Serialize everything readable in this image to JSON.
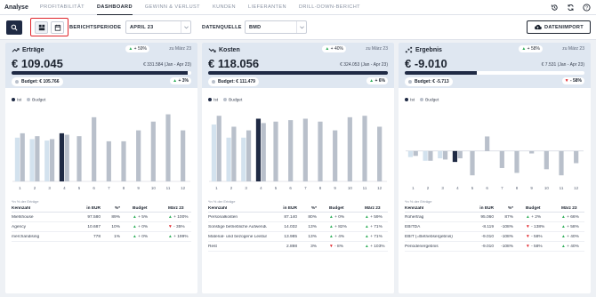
{
  "app": {
    "name": "Analyse",
    "profit_label": "PROFITABILITÄT"
  },
  "nav": [
    {
      "label": "DASHBOARD",
      "active": true
    },
    {
      "label": "GEWINN & VERLUST",
      "active": false
    },
    {
      "label": "KUNDEN",
      "active": false
    },
    {
      "label": "LIEFERANTEN",
      "active": false
    },
    {
      "label": "DRILL-DOWN-BERICHT",
      "active": false
    }
  ],
  "toolbar": {
    "period_label": "BERICHTSPERIODE",
    "period_value": "APRIL 23",
    "source_label": "DATENQUELLE",
    "source_value": "BMD",
    "import_label": "DATENIMPORT"
  },
  "colors": {
    "accent": "#1f2a44",
    "ist_past": "#d3e2ee",
    "budget": "#b9c0cb",
    "up": "#2fae5a",
    "down": "#e0252b",
    "highlight_border": "#e0252b"
  },
  "cards": [
    {
      "title": "Erträge",
      "icon": "trend-up-icon",
      "delta": "+ 59%",
      "delta_dir": "up",
      "delta_ref": "zu März 23",
      "value": "€ 109.045",
      "prev": "€ 331.584 (Jan - Apr 23)",
      "progress": 0.98,
      "budget": "Budget: € 105.766",
      "budget_delta": "+ 3%",
      "budget_dir": "up",
      "legend": {
        "ist": "Ist",
        "budget": "Budget"
      },
      "footnote": "*in % der Erträge",
      "headers": [
        "Kennzahl",
        "in EUR",
        "%*",
        "Budget",
        "März 23"
      ],
      "rows": [
        {
          "name": "Mietshouse",
          "eur": "97.580",
          "pct": "89%",
          "budget": "+ 5%",
          "budget_dir": "up",
          "mar": "+ 100%",
          "mar_dir": "up"
        },
        {
          "name": "Agency",
          "eur": "10.687",
          "pct": "10%",
          "budget": "+ 0%",
          "budget_dir": "up",
          "mar": "- 35%",
          "mar_dir": "down"
        },
        {
          "name": "merchandising",
          "eur": "778",
          "pct": "1%",
          "budget": "+ 0%",
          "budget_dir": "up",
          "mar": "+ 199%",
          "mar_dir": "up"
        }
      ]
    },
    {
      "title": "Kosten",
      "icon": "trend-down-icon",
      "delta": "+ 40%",
      "delta_dir": "up",
      "delta_ref": "zu März 23",
      "value": "€ 118.056",
      "prev": "€ 324.053 (Jan - Apr 23)",
      "progress": 1.0,
      "budget": "Budget: € 111.479",
      "budget_delta": "+ 6%",
      "budget_dir": "up",
      "legend": {
        "ist": "Ist",
        "budget": "Budget"
      },
      "footnote": "*in % der Erträge",
      "headers": [
        "Kennzahl",
        "in EUR",
        "%*",
        "Budget",
        "März 23"
      ],
      "rows": [
        {
          "name": "Personalkosten",
          "eur": "87.140",
          "pct": "80%",
          "budget": "+ 0%",
          "budget_dir": "up",
          "mar": "+ 59%",
          "mar_dir": "up"
        },
        {
          "name": "Sonstige betriebliche Aufwendungen",
          "eur": "14.032",
          "pct": "13%",
          "budget": "+ 82%",
          "budget_dir": "up",
          "mar": "+ 71%",
          "mar_dir": "up"
        },
        {
          "name": "Material- und bezogene Leistungen",
          "eur": "13.985",
          "pct": "13%",
          "budget": "+ 4%",
          "budget_dir": "up",
          "mar": "+ 71%",
          "mar_dir": "up"
        },
        {
          "name": "Rest",
          "eur": "2.898",
          "pct": "3%",
          "budget": "- 8%",
          "budget_dir": "down",
          "mar": "+ 103%",
          "mar_dir": "up"
        }
      ]
    },
    {
      "title": "Ergebnis",
      "icon": "scatter-icon",
      "delta": "+ 58%",
      "delta_dir": "up",
      "delta_ref": "zu März 23",
      "value": "€ -9.010",
      "prev": "€ 7.531 (Jan - Apr 23)",
      "progress": 0.4,
      "budget": "Budget: € -5.713",
      "budget_delta": "- 58%",
      "budget_dir": "down",
      "legend": {
        "ist": "Ist",
        "budget": "Budget"
      },
      "footnote": "*in % der Erträge",
      "headers": [
        "Kennzahl",
        "in EUR",
        "%*",
        "Budget",
        "März 23"
      ],
      "rows": [
        {
          "name": "Rohertrag",
          "eur": "95.060",
          "pct": "87%",
          "budget": "+ 2%",
          "budget_dir": "up",
          "mar": "+ 66%",
          "mar_dir": "up"
        },
        {
          "name": "EBITDA",
          "eur": "-8.119",
          "pct": "-108%",
          "budget": "- 138%",
          "budget_dir": "down",
          "mar": "+ 58%",
          "mar_dir": "up"
        },
        {
          "name": "EBIT (=Betriebsergebnis)",
          "eur": "-9.010",
          "pct": "-108%",
          "budget": "- 58%",
          "budget_dir": "down",
          "mar": "+ 40%",
          "mar_dir": "up"
        },
        {
          "name": "Periodenergebnis",
          "eur": "-9.010",
          "pct": "-108%",
          "budget": "- 58%",
          "budget_dir": "down",
          "mar": "+ 40%",
          "mar_dir": "up"
        }
      ]
    }
  ],
  "chart_data": [
    {
      "type": "bar",
      "title": "Erträge",
      "categories": [
        "1",
        "2",
        "3",
        "4",
        "5",
        "6",
        "7",
        "8",
        "9",
        "10",
        "11",
        "12"
      ],
      "series": [
        {
          "name": "Ist",
          "values": [
            60,
            58,
            56,
            66,
            null,
            null,
            null,
            null,
            null,
            null,
            null,
            null
          ]
        },
        {
          "name": "Budget",
          "values": [
            66,
            62,
            58,
            64,
            62,
            88,
            55,
            55,
            70,
            82,
            92,
            70
          ]
        }
      ],
      "ylim": [
        0,
        100
      ],
      "current_index": 3
    },
    {
      "type": "bar",
      "title": "Kosten",
      "categories": [
        "1",
        "2",
        "3",
        "4",
        "5",
        "6",
        "7",
        "8",
        "9",
        "10",
        "11",
        "12"
      ],
      "series": [
        {
          "name": "Ist",
          "values": [
            78,
            60,
            60,
            86,
            null,
            null,
            null,
            null,
            null,
            null,
            null,
            null
          ]
        },
        {
          "name": "Budget",
          "values": [
            90,
            75,
            70,
            80,
            82,
            84,
            86,
            82,
            70,
            88,
            90,
            75
          ]
        }
      ],
      "ylim": [
        0,
        100
      ],
      "current_index": 3
    },
    {
      "type": "bar",
      "title": "Ergebnis",
      "categories": [
        "1",
        "2",
        "3",
        "4",
        "5",
        "6",
        "7",
        "8",
        "9",
        "10",
        "11",
        "12"
      ],
      "series": [
        {
          "name": "Ist",
          "values": [
            -5,
            -8,
            -6,
            -9,
            null,
            null,
            null,
            null,
            null,
            null,
            null,
            null
          ]
        },
        {
          "name": "Budget",
          "values": [
            -4,
            -8,
            -7,
            -6,
            -20,
            12,
            -14,
            -18,
            -2,
            -15,
            -20,
            -10
          ]
        }
      ],
      "ylim": [
        -25,
        35
      ],
      "current_index": 3
    }
  ]
}
